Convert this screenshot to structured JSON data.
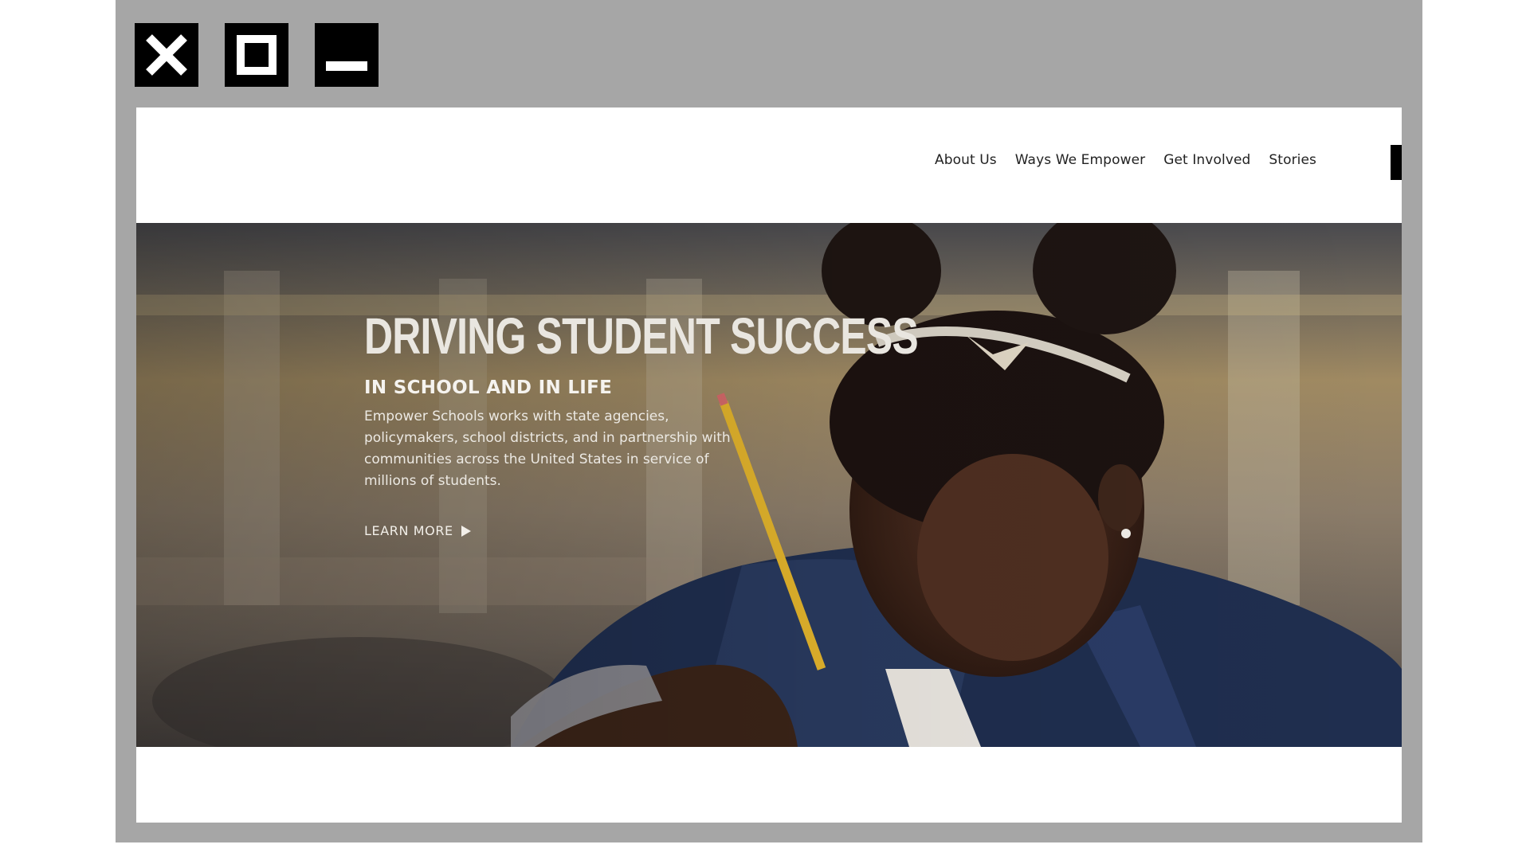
{
  "window_controls": {
    "close_icon": "close-icon",
    "maximize_icon": "maximize-icon",
    "minimize_icon": "minimize-icon"
  },
  "nav": {
    "items": [
      {
        "label": "About Us"
      },
      {
        "label": "Ways We Empower"
      },
      {
        "label": "Get Involved"
      },
      {
        "label": "Stories"
      }
    ]
  },
  "hero": {
    "title": "DRIVING STUDENT SUCCESS",
    "subtitle": "IN SCHOOL AND IN LIFE",
    "description": "Empower Schools works with state agencies, policymakers, school districts, and in partnership with communities across the United States in service of millions of students.",
    "cta_label": "LEARN MORE",
    "cta_icon": "play-arrow-icon"
  },
  "colors": {
    "frame": "#a6a6a6",
    "window_button": "#000000",
    "page_background": "#ffffff",
    "hero_text": "#ece9e3",
    "nav_text": "#222222"
  }
}
